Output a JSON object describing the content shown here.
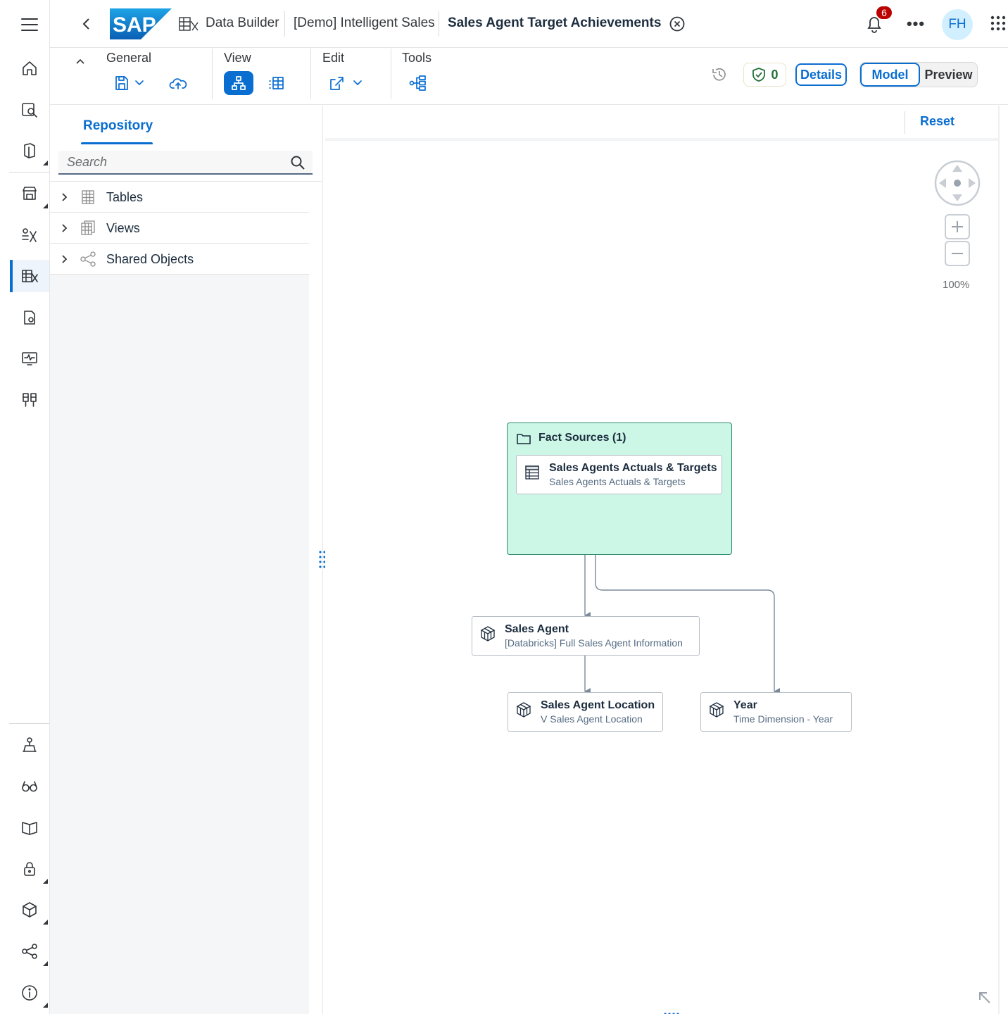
{
  "shell": {
    "logo_text": "SAP",
    "breadcrumbs": [
      {
        "label": "Data Builder"
      },
      {
        "label": "[Demo] Intelligent Sales"
      },
      {
        "label": "Sales Agent Target Achievements"
      }
    ],
    "notification_count": "6",
    "more_label": "•••",
    "avatar_initials": "FH"
  },
  "toolbar": {
    "groups": {
      "general": "General",
      "view": "View",
      "edit": "Edit",
      "tools": "Tools"
    },
    "validation_count": "0",
    "details_label": "Details",
    "mode_model": "Model",
    "mode_preview": "Preview",
    "active_mode": "Model"
  },
  "repository": {
    "tab_label": "Repository",
    "search_placeholder": "Search",
    "items": [
      {
        "label": "Tables",
        "icon": "table-icon"
      },
      {
        "label": "Views",
        "icon": "view-icon"
      },
      {
        "label": "Shared Objects",
        "icon": "share-icon"
      }
    ]
  },
  "canvas": {
    "reset_label": "Reset",
    "zoom_level": "100%",
    "group": {
      "title": "Fact Sources (1)"
    },
    "nodes": {
      "fact": {
        "title": "Sales Agents Actuals & Targets",
        "subtitle": "Sales Agents Actuals & Targets"
      },
      "sales_agent": {
        "title": "Sales Agent",
        "subtitle": "[Databricks] Full Sales Agent Information"
      },
      "location": {
        "title": "Sales Agent Location",
        "subtitle": "V Sales Agent Location"
      },
      "year": {
        "title": "Year",
        "subtitle": "Time Dimension - Year"
      }
    }
  },
  "colors": {
    "accent": "#0a6ed1",
    "group_fill": "#ccf7e7",
    "group_border": "#2f8a6a",
    "badge": "#bb0000",
    "validation_ok": "#256f3a"
  }
}
